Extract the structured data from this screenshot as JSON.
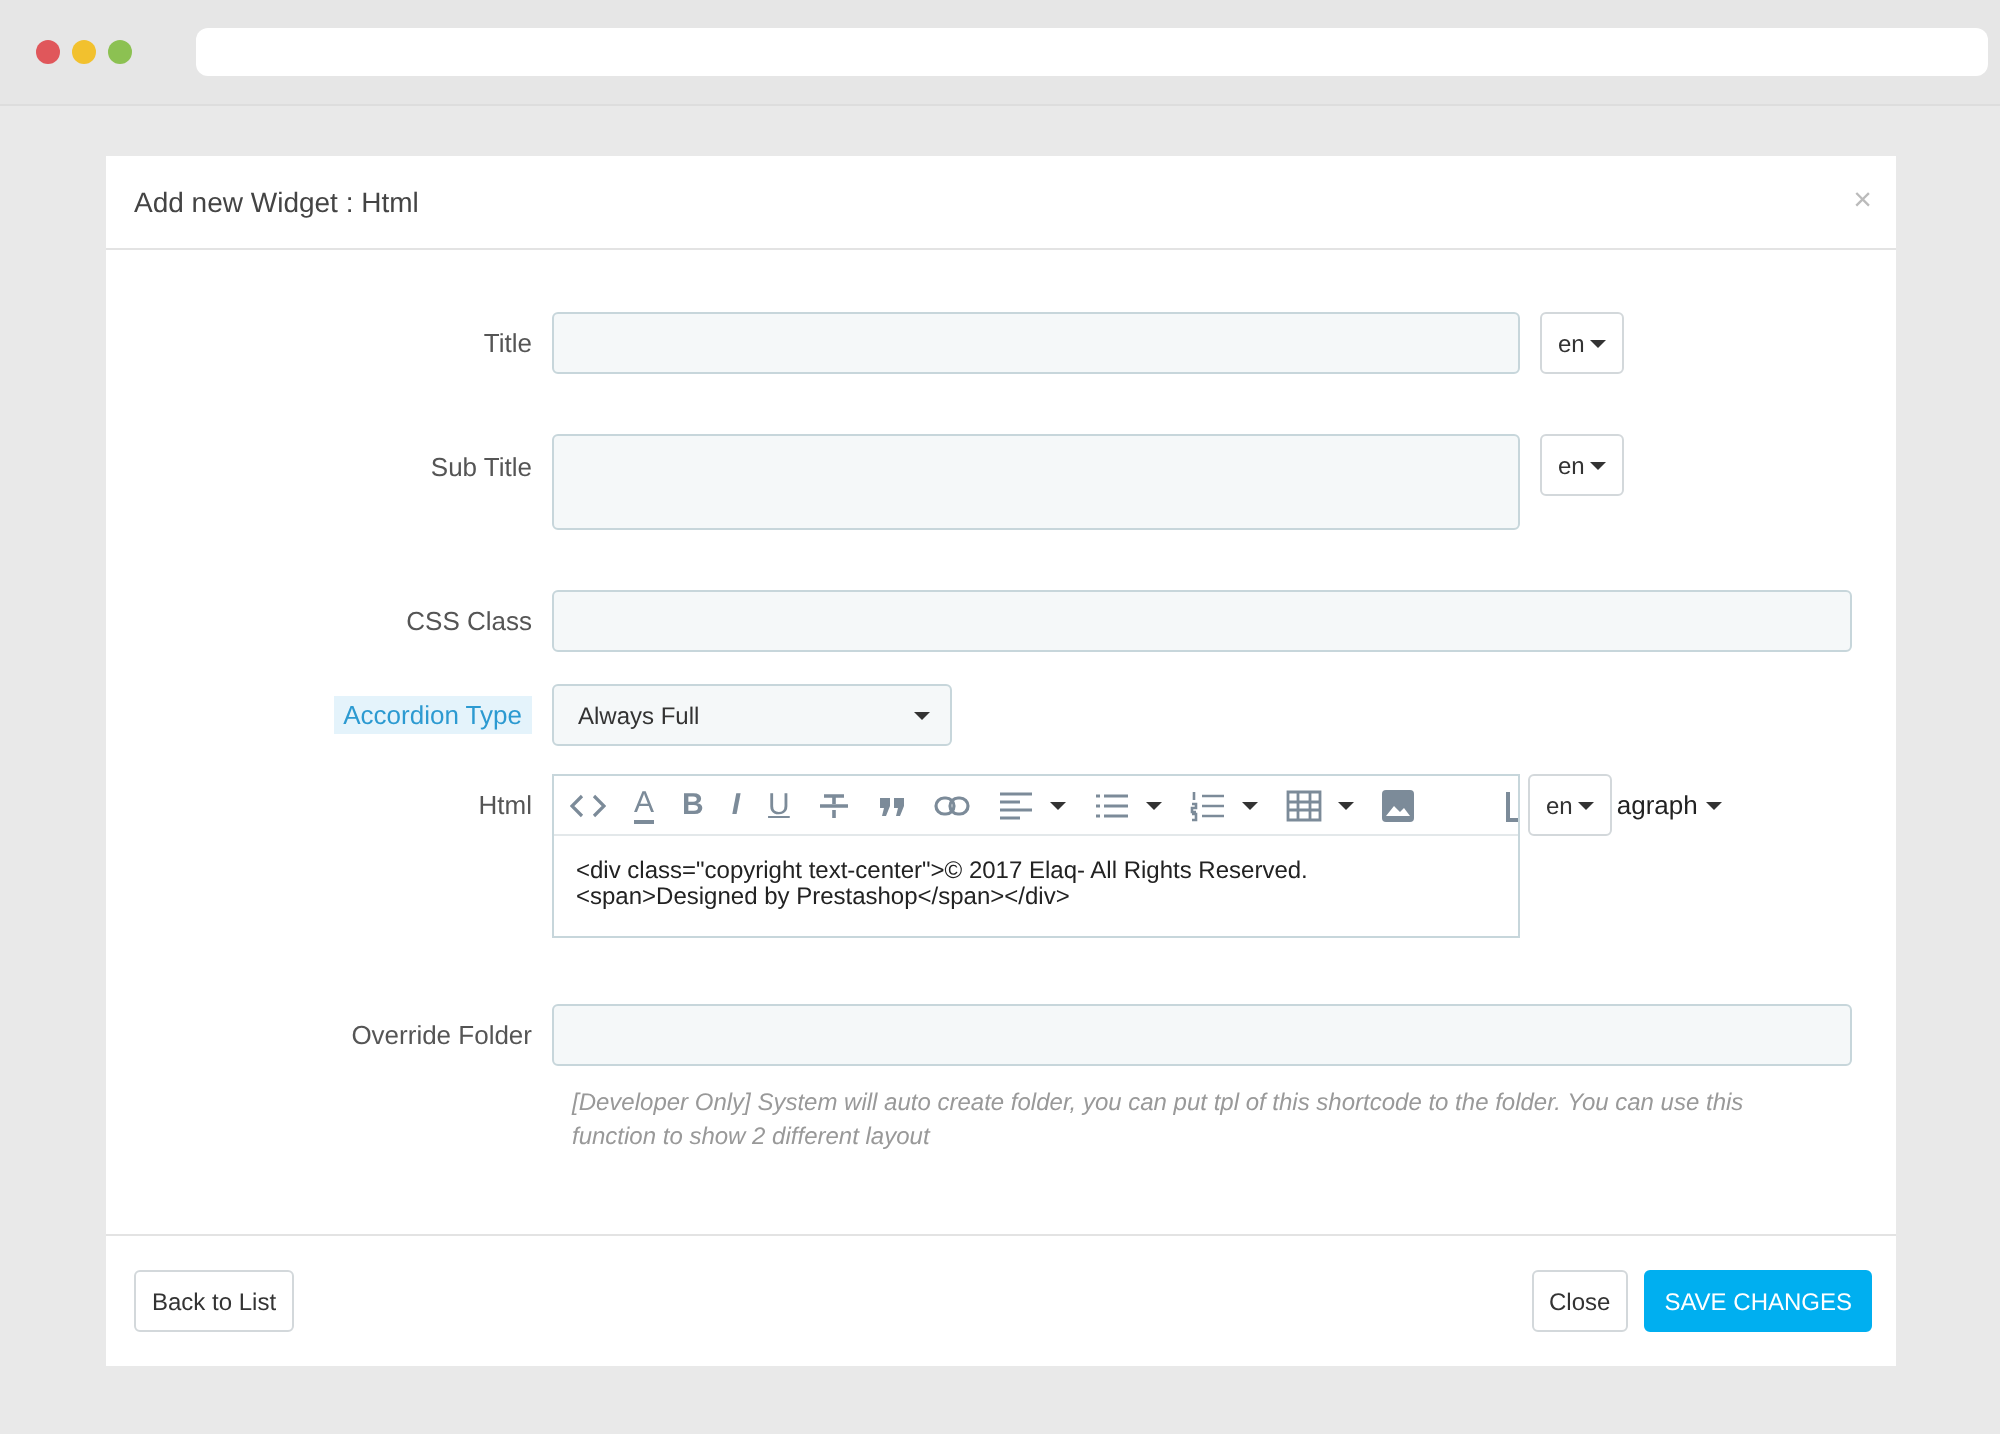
{
  "modal": {
    "title": "Add new Widget : Html",
    "close": "×"
  },
  "form": {
    "title": {
      "label": "Title",
      "lang": "en"
    },
    "sub_title": {
      "label": "Sub Title",
      "lang": "en"
    },
    "css_class": {
      "label": "CSS Class"
    },
    "accordion_type": {
      "label": "Accordion Type",
      "value": "Always Full",
      "highlighted": true
    },
    "html": {
      "label": "Html",
      "lang": "en",
      "overflow_text": "agraph",
      "toolbar": [
        {
          "kind": "code",
          "dropdown": false
        },
        {
          "kind": "fontcolor",
          "label": "A",
          "dropdown": false
        },
        {
          "kind": "bold",
          "label": "B",
          "dropdown": false
        },
        {
          "kind": "italic",
          "label": "I",
          "dropdown": false
        },
        {
          "kind": "underline",
          "label": "U",
          "dropdown": false
        },
        {
          "kind": "strike",
          "dropdown": false
        },
        {
          "kind": "quote",
          "dropdown": false
        },
        {
          "kind": "link",
          "dropdown": false
        },
        {
          "kind": "align",
          "dropdown": true
        },
        {
          "kind": "bullets",
          "dropdown": true
        },
        {
          "kind": "numbers",
          "dropdown": true
        },
        {
          "kind": "table",
          "dropdown": true
        },
        {
          "kind": "image",
          "dropdown": false
        }
      ],
      "content": [
        "<div class=\"copyright text-center\">© 2017 Elaq- All Rights Reserved.",
        "<span>Designed by Prestashop</span></div>"
      ]
    },
    "override_folder": {
      "label": "Override Folder",
      "help": "[Developer Only] System will auto create folder, you can put tpl of this shortcode to the folder. You can use this function to show 2 different layout"
    }
  },
  "footer": {
    "back": "Back to List",
    "close": "Close",
    "save": "SAVE CHANGES"
  }
}
